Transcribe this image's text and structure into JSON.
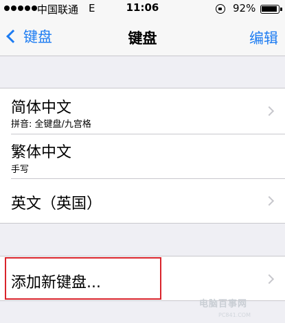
{
  "status_bar": {
    "carrier": "中国联通",
    "network": "E",
    "time": "11:06",
    "battery": "92%",
    "battery_level": 0.92
  },
  "nav": {
    "back_label": "键盘",
    "title": "键盘",
    "edit_label": "编辑"
  },
  "keyboards": [
    {
      "title": "简体中文",
      "subtitle": "拼音: 全键盘/九宫格"
    },
    {
      "title": "繁体中文",
      "subtitle": "手写"
    },
    {
      "title": "英文（英国）"
    }
  ],
  "add_keyboard": {
    "label": "添加新键盘..."
  },
  "watermark": {
    "text": "电脑百事网",
    "url": "PC841.COM"
  },
  "colors": {
    "accent": "#1d7cf2",
    "highlight": "#d9232b",
    "background": "#efeff4"
  }
}
